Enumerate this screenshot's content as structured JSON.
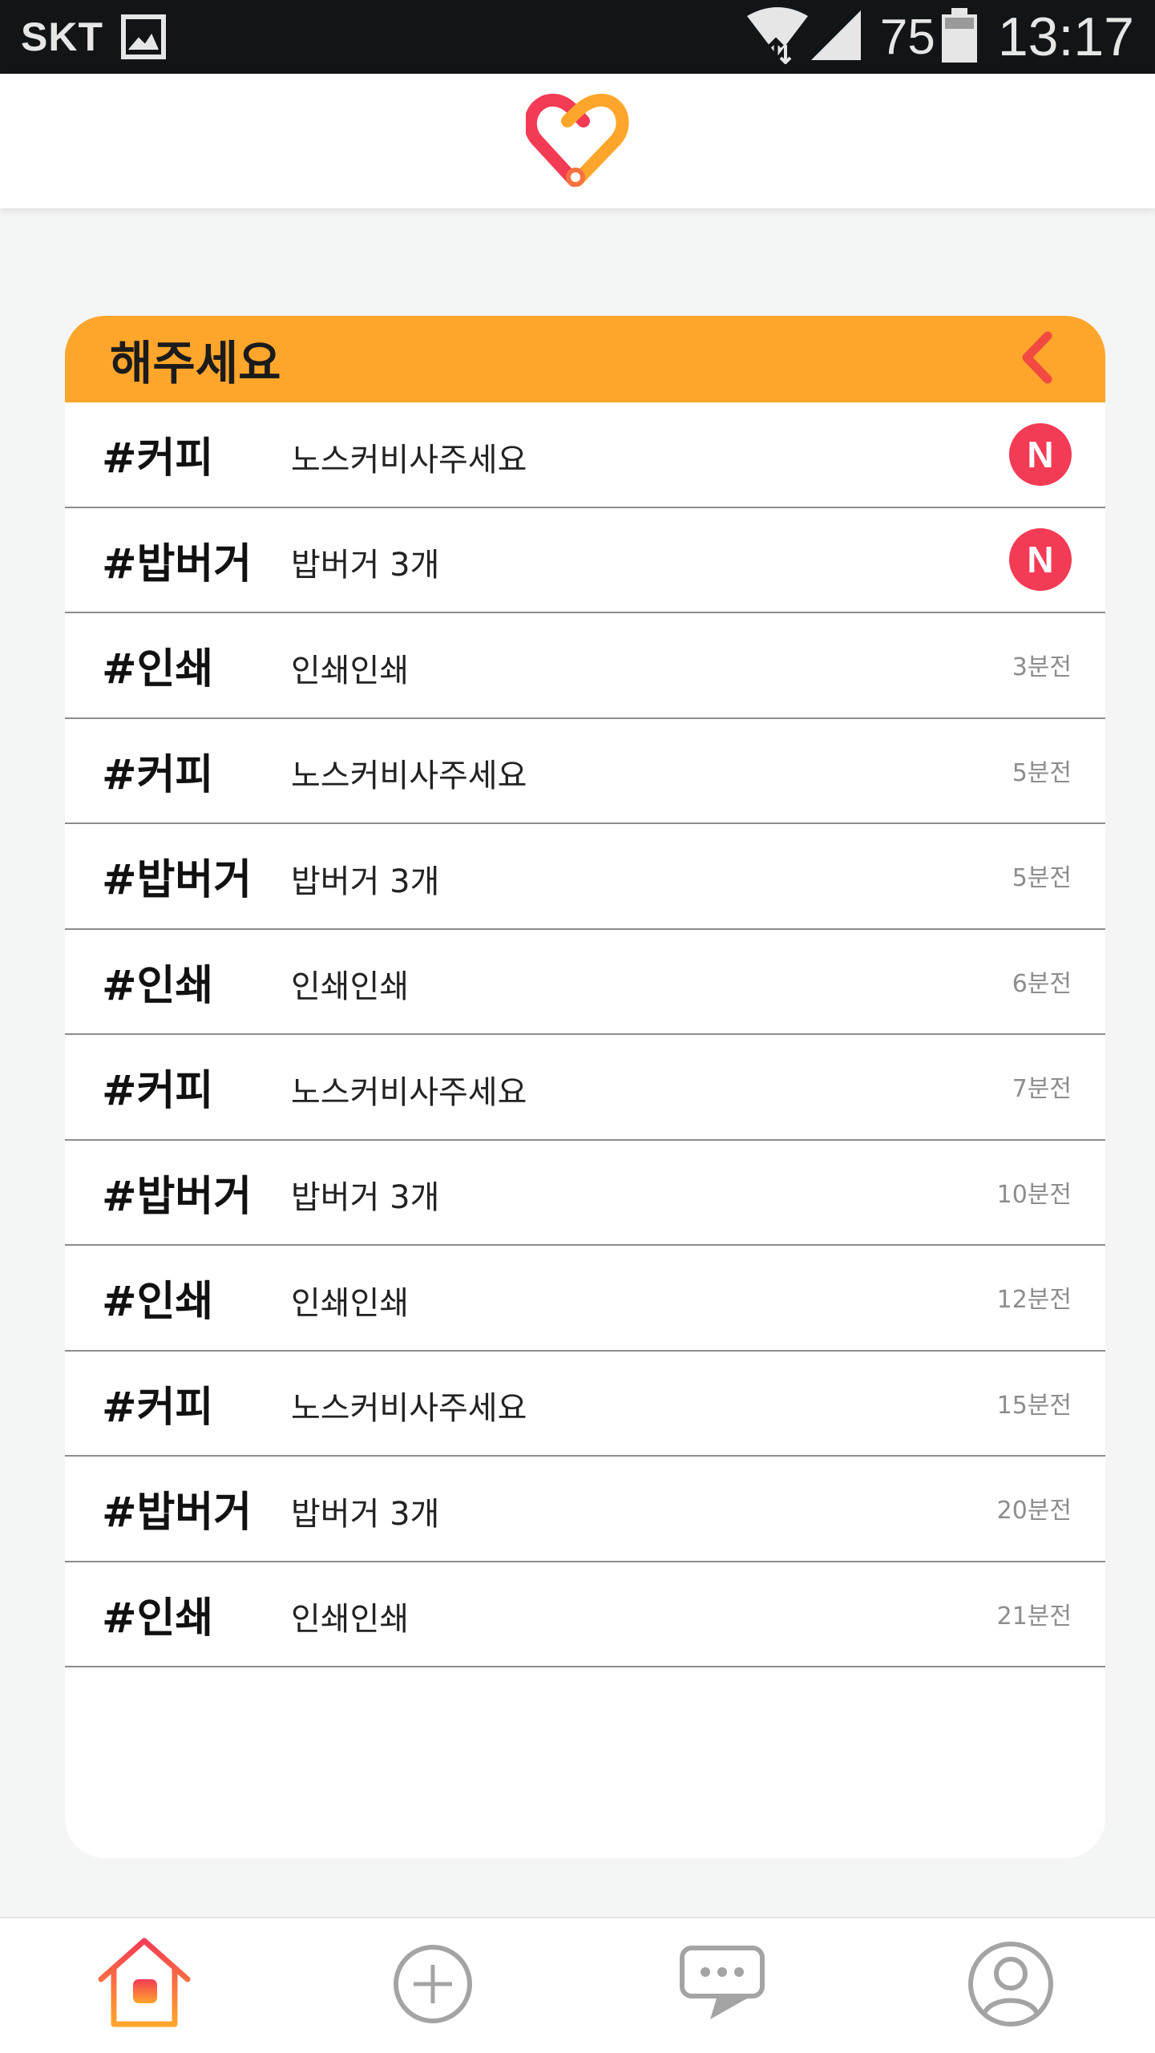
{
  "status_bar": {
    "carrier": "SKT",
    "battery": "75",
    "time": "13:17",
    "icons": [
      "gallery-icon",
      "wifi-icon",
      "signal-icon",
      "battery-icon"
    ]
  },
  "header": {
    "logo": "heart-logo-icon",
    "colors": {
      "red": "#f43b55",
      "orange": "#fea62c"
    }
  },
  "card": {
    "title": "해주세요",
    "header_color": "#fea62c",
    "back_icon": "chevron-left-icon",
    "badge_label": "N",
    "items": [
      {
        "tag": "#커피",
        "message": "노스커비사주세요",
        "time": "",
        "is_new": true
      },
      {
        "tag": "#밥버거",
        "message": "밥버거 3개",
        "time": "",
        "is_new": true
      },
      {
        "tag": "#인쇄",
        "message": "인쇄인쇄",
        "time": "3분전",
        "is_new": false
      },
      {
        "tag": "#커피",
        "message": "노스커비사주세요",
        "time": "5분전",
        "is_new": false
      },
      {
        "tag": "#밥버거",
        "message": "밥버거 3개",
        "time": "5분전",
        "is_new": false
      },
      {
        "tag": "#인쇄",
        "message": "인쇄인쇄",
        "time": "6분전",
        "is_new": false
      },
      {
        "tag": "#커피",
        "message": "노스커비사주세요",
        "time": "7분전",
        "is_new": false
      },
      {
        "tag": "#밥버거",
        "message": "밥버거 3개",
        "time": "10분전",
        "is_new": false
      },
      {
        "tag": "#인쇄",
        "message": "인쇄인쇄",
        "time": "12분전",
        "is_new": false
      },
      {
        "tag": "#커피",
        "message": "노스커비사주세요",
        "time": "15분전",
        "is_new": false
      },
      {
        "tag": "#밥버거",
        "message": "밥버거 3개",
        "time": "20분전",
        "is_new": false
      },
      {
        "tag": "#인쇄",
        "message": "인쇄인쇄",
        "time": "21분전",
        "is_new": false
      }
    ]
  },
  "bottom_nav": {
    "items": [
      {
        "icon": "home-icon",
        "active": true
      },
      {
        "icon": "add-circle-icon",
        "active": false
      },
      {
        "icon": "chat-icon",
        "active": false
      },
      {
        "icon": "profile-icon",
        "active": false
      }
    ]
  }
}
